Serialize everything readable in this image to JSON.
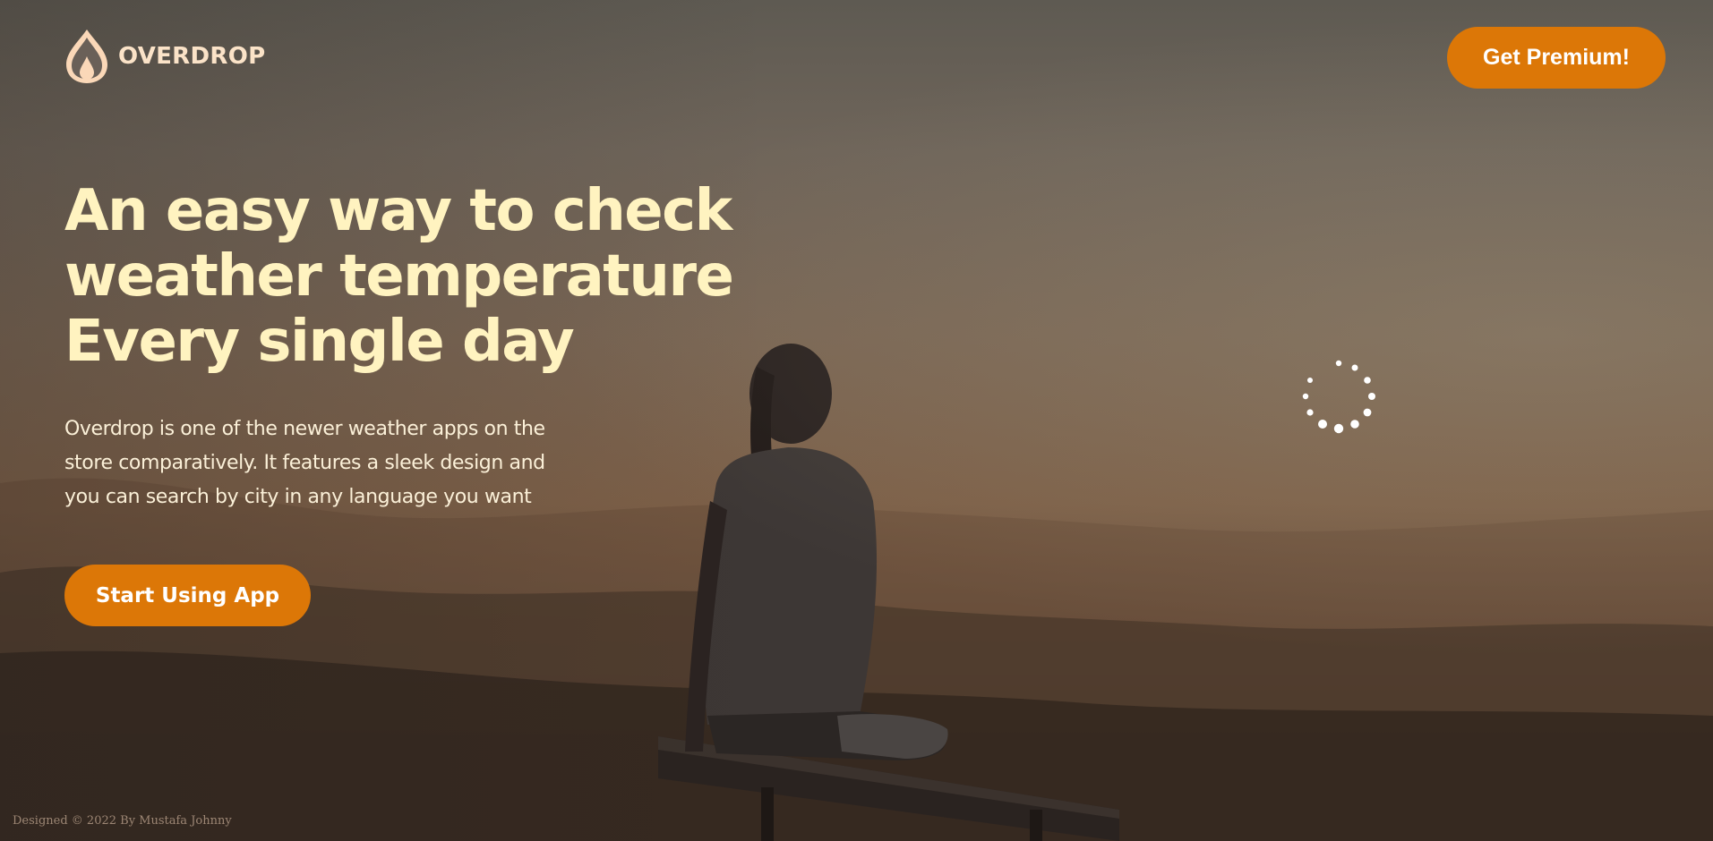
{
  "brand": {
    "name": "OVERDROP",
    "logo_icon": "drop-icon"
  },
  "header": {
    "premium_label": "Get Premium!"
  },
  "hero": {
    "title_lines": [
      "An easy way to check",
      "weather temperature",
      "Every single day"
    ],
    "description": "Overdrop is one of the newer weather apps on the store comparatively. It features a sleek design and you can search by city in any language you want",
    "cta_label": "Start Using App"
  },
  "loader": {
    "icon": "loading-spinner-icon"
  },
  "footer": {
    "credit": "Designed © 2022 By Mustafa Johnny"
  },
  "colors": {
    "accent": "#dc7707",
    "heading": "#fff3c0",
    "logo": "#fbe3c8"
  }
}
